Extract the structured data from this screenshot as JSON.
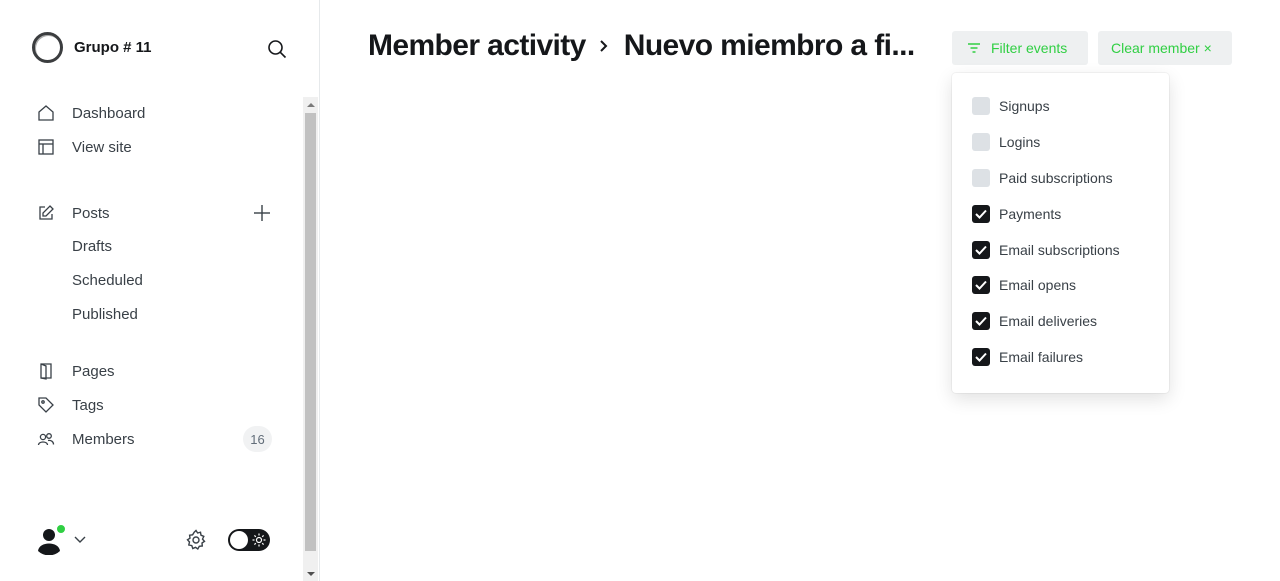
{
  "sidebar": {
    "site_name": "Grupo # 11",
    "nav": {
      "dashboard": "Dashboard",
      "view_site": "View site",
      "posts": "Posts",
      "drafts": "Drafts",
      "scheduled": "Scheduled",
      "published": "Published",
      "pages": "Pages",
      "tags": "Tags",
      "members": "Members",
      "members_count": "16"
    },
    "icons": [
      "search-icon",
      "home-icon",
      "layout-icon",
      "edit-icon",
      "plus-icon",
      "page-icon",
      "tag-icon",
      "members-icon",
      "chevron-down-icon",
      "gear-icon",
      "sun-icon"
    ]
  },
  "header": {
    "breadcrumb_parent": "Member activity",
    "breadcrumb_current": "Nuevo miembro a fi...",
    "filter_button": "Filter events",
    "clear_button": "Clear member ×"
  },
  "filter_options": [
    {
      "label": "Signups",
      "checked": false
    },
    {
      "label": "Logins",
      "checked": false
    },
    {
      "label": "Paid subscriptions",
      "checked": false
    },
    {
      "label": "Payments",
      "checked": true
    },
    {
      "label": "Email subscriptions",
      "checked": true
    },
    {
      "label": "Email opens",
      "checked": true
    },
    {
      "label": "Email deliveries",
      "checked": true
    },
    {
      "label": "Email failures",
      "checked": true
    }
  ],
  "colors": {
    "accent": "#30cf43",
    "text": "#15171a",
    "button_bg": "#eef0f1",
    "checkbox_off": "#dde1e5"
  }
}
